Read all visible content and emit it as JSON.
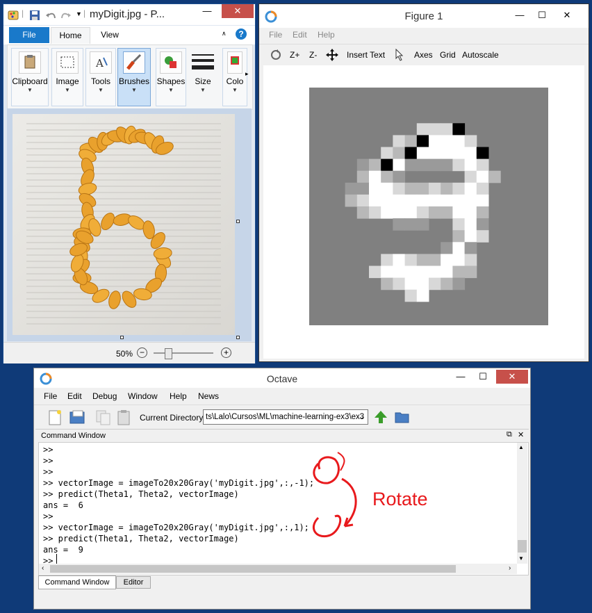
{
  "paint": {
    "title": "myDigit.jpg - P...",
    "tabs": {
      "file": "File",
      "home": "Home",
      "view": "View"
    },
    "help_label": "?",
    "groups": [
      "Clipboard",
      "Image",
      "Tools",
      "Brushes",
      "Shapes",
      "Size",
      "Colo"
    ],
    "zoom": "50%"
  },
  "figure": {
    "title": "Figure 1",
    "menu": [
      "File",
      "Edit",
      "Help"
    ],
    "toolbar": {
      "zoom_in": "Z+",
      "zoom_out": "Z-",
      "insert_text": "Insert Text",
      "axes": "Axes",
      "grid": "Grid",
      "autoscale": "Autoscale"
    },
    "digit_pixels": [
      "....................",
      "....................",
      "....................",
      ".........lllw.......",
      ".......lmwWWWl......",
      "......lmwWWWWWw.....",
      "....dmwWddddlWl.....",
      "....mWmd.....lWm....",
      "...ddWWlmmlmlWl.....",
      "...mlWWWWWWWWWW.....",
      "....mlWWWlmmWWm.....",
      ".......ddd..lWd.....",
      "............mWl.....",
      "...........dWd......",
      "......lWlmmWWl......",
      ".....lWWWWWWmm......",
      "......mlWWlmd.......",
      "........lW..........",
      "....................",
      "...................."
    ]
  },
  "octave": {
    "title": "Octave",
    "menu": [
      "File",
      "Edit",
      "Debug",
      "Window",
      "Help",
      "News"
    ],
    "current_dir_label": "Current Directory:",
    "current_dir_value": "ts\\Lalo\\Cursos\\ML\\machine-learning-ex3\\ex3",
    "panel_title": "Command Window",
    "lines": [
      ">>",
      ">>",
      ">>",
      ">> vectorImage = imageTo20x20Gray('myDigit.jpg',:,-1);",
      ">> predict(Theta1, Theta2, vectorImage)",
      "ans =  6",
      ">>",
      ">> vectorImage = imageTo20x20Gray('myDigit.jpg',:,1);",
      ">> predict(Theta1, Theta2, vectorImage)",
      "ans =  9",
      ">> "
    ],
    "annotation": "Rotate",
    "bottom_tabs": [
      "Command Window",
      "Editor"
    ]
  },
  "colors": {
    "desktop": "#0f3a78",
    "close": "#c7504a",
    "file_tab": "#1979ca",
    "annotation": "#e8191c"
  }
}
